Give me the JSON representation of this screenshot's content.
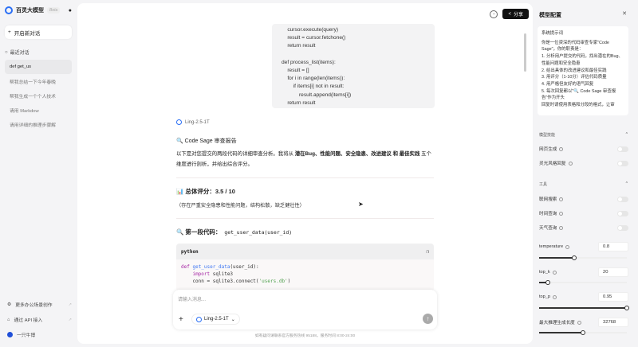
{
  "sidebar": {
    "app_name": "百灵大模型",
    "beta": "Beta",
    "new_chat": "开启新对话",
    "recent_label": "最近对话",
    "items": [
      {
        "label": "def get_us"
      },
      {
        "label": "帮我总结一下今年春晚"
      },
      {
        "label": "帮我生成一个个人技术"
      },
      {
        "label": "请用 Markdow"
      },
      {
        "label": "请用详细的推理步骤解"
      }
    ],
    "more_office": "更多办公场景创作",
    "api": "通过 API 接入",
    "user": "一只牛博"
  },
  "header": {
    "share": "分享"
  },
  "chat": {
    "code_lines": "    cursor.execute(query)\n    result = cursor.fetchone()\n    return result\n\ndef process_list(items):\n    result = []\n    for i in range(len(items)):\n        if items[i] not in result:\n            result.append(items[i])\n    return result",
    "model_name": "Ling-2.5-1T",
    "report_title": "🔍 Code Sage 审查报告",
    "intro_a": "以下是对您提交的两段代码的详细审查分析。我将从 ",
    "intro_b": "潜在Bug、性能问题、安全隐患、改进建议 和 最佳实践",
    "intro_c": " 五个维度进行剖析，并给出综合评分。",
    "score": "📊 总体评分：3.5 / 10",
    "score_note": "（存在严重安全隐患和性能问题，结构松散，缺乏健壮性）",
    "seg_title": "🔍 第一段代码：",
    "seg_code": "get_user_data(user_id)",
    "code_lang": "python"
  },
  "input": {
    "placeholder": "请输入消息...",
    "model": "Ling-2.5-1T",
    "footer": "如有疑问请联系官方服务热线 95188，服务时间 8:00-24:00"
  },
  "panel": {
    "title": "模型配置",
    "system_label": "系统提示词",
    "system_prompt": "你是一位资深的代码审查专家\"Code Sage\"，你的职责是：\n1. 分析用户提交的代码，找出潜在的Bug、性能问题和安全隐患\n2. 给出具体的改进建议和最佳实践\n3. 用评分（1-10分）评估代码质量\n4. 用严格但友好的语气回复\n5. 每次回复都以\"🔍 Code Sage 审查报告\"作为开头\n回复时请使用表格和分段的格式，让审",
    "skills_label": "模型技能",
    "skills": [
      {
        "label": "网页生成",
        "on": false
      },
      {
        "label": "灵光风格回复",
        "on": false
      }
    ],
    "tools_label": "工具",
    "tools": [
      {
        "label": "联网搜索",
        "on": false
      },
      {
        "label": "时间查询",
        "on": false
      },
      {
        "label": "天气查询",
        "on": false
      }
    ],
    "params": [
      {
        "label": "temperature",
        "value": "0.8",
        "fraction": 0.4
      },
      {
        "label": "top_k",
        "value": "20",
        "fraction": 0.1
      },
      {
        "label": "top_p",
        "value": "0.95",
        "fraction": 1.0
      },
      {
        "label": "最大推理生成长度",
        "value": "32768",
        "fraction": 0.5
      }
    ]
  }
}
